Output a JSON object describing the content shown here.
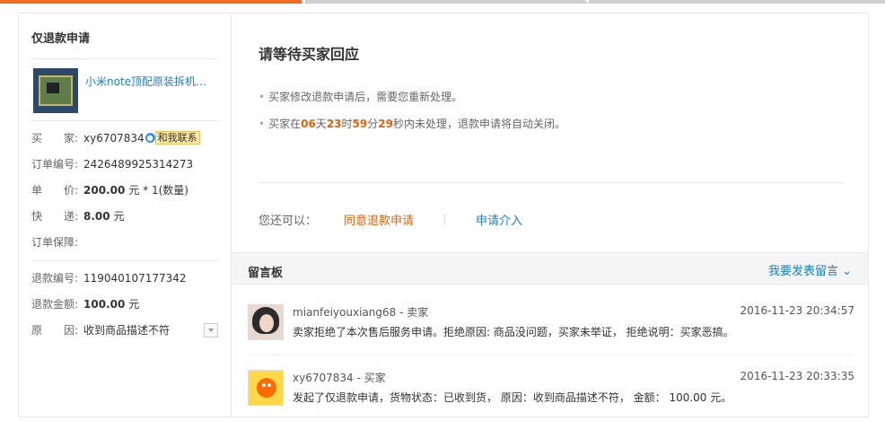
{
  "left": {
    "title": "仅退款申请",
    "product_title": "小米note顶配原装拆机坏…",
    "buyer_label": "买　　家:",
    "buyer_name": "xy6707834",
    "contact_label": "和我联系",
    "order_label": "订单编号:",
    "order_value": "2426489925314273",
    "price_label": "单　　价:",
    "price_value": "200.00",
    "price_suffix": "元 * 1(数量)",
    "shipping_label": "快　　递:",
    "shipping_value": "8.00",
    "shipping_unit": "元",
    "guarantee_label": "订单保障:",
    "refund_no_label": "退款编号:",
    "refund_no_value": "119040107177342",
    "refund_amount_label": "退款金额:",
    "refund_amount_value": "100.00",
    "refund_amount_unit": "元",
    "reason_label": "原　　因:",
    "reason_value": "收到商品描述不符"
  },
  "main": {
    "heading": "请等待买家回应",
    "bullet1": "买家修改退款申请后，需要您重新处理。",
    "bullet2_prefix": "买家在",
    "days": "06",
    "days_unit": "天",
    "hours": "23",
    "hours_unit": "时",
    "minutes": "59",
    "minutes_unit": "分",
    "seconds": "29",
    "seconds_unit": "秒",
    "bullet2_suffix": "内未处理，退款申请将自动关闭。",
    "actions_label": "您还可以：",
    "agree_label": "同意退款申请",
    "intervene_label": "申请介入"
  },
  "messages": {
    "title": "留言板",
    "post_label": "我要发表留言",
    "items": [
      {
        "who": "mianfeiyouxiang68 - 卖家",
        "time": "2016-11-23 20:34:57",
        "text": "卖家拒绝了本次售后服务申请。拒绝原因: 商品没问题，买家未举证， 拒绝说明：买家恶搞。"
      },
      {
        "who": "xy6707834 - 买家",
        "time": "2016-11-23 20:33:35",
        "text": "发起了仅退款申请，货物状态：已收到货， 原因：收到商品描述不符， 金额： 100.00 元。"
      }
    ]
  },
  "colors": {
    "accent_orange": "#e0620d",
    "link_blue": "#1a7fc3",
    "progress_orange": "#f36a1e"
  }
}
